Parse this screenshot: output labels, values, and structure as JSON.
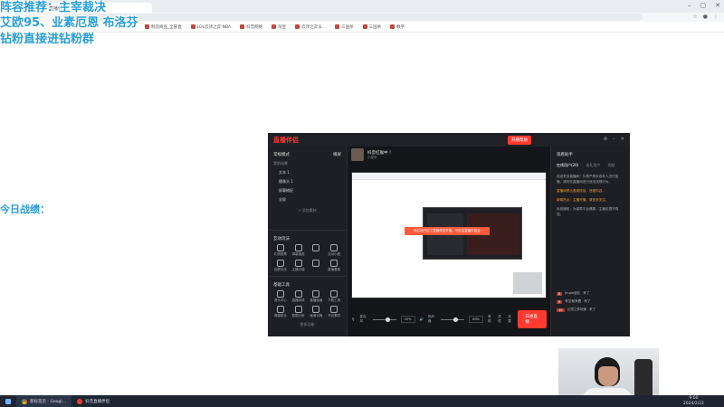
{
  "overlay": {
    "line1": "阵容推荐：主宰裁决",
    "line2": "艾欧95、业素厄恩  布洛芬",
    "line3": "钻粉直接进钻粉群",
    "line4": "今日战绩："
  },
  "browser": {
    "active_tab": "直播伴侣",
    "bookmarks": [
      "制造商品_全部直",
      "LOL云顶之弈·NBA",
      "抖音网络",
      "淘宝",
      "云顶之弈法…",
      "三国杀",
      "三国杀",
      "数字"
    ]
  },
  "app": {
    "logo": "直播伴侣",
    "start_live_top": "开播帮助",
    "left": {
      "mode": "常规模式",
      "right_link": "横屏",
      "scenes_label": "我的场景",
      "scene_items": [
        "文本 1",
        "摄像头 1",
        "屏幕捕捉",
        "全屏"
      ],
      "add_source": "+ 添加素材",
      "interactive_title": "互动玩法",
      "interactive_tools": [
        "礼物投票",
        "弹幕抽奖",
        "",
        "互动小程",
        "抽奖玩法",
        "主播口袋",
        "",
        "直播看板"
      ],
      "basic_title": "基础工具",
      "basic_tools": [
        "音乐中心",
        "直播特效",
        "直播画面",
        "下载工具",
        "弹幕助手",
        "数据分析",
        "画面切换",
        "节目素材"
      ],
      "more": "更多功能"
    },
    "center": {
      "streamer_name": "抖音红猴中 ！",
      "streamer_sub": "小皇帝",
      "toast": "你已经开启了直播伴侣开播，可前往直播中控台",
      "cam_label": "麦克风",
      "cam_pct": "10%",
      "mic_label": "扬声器",
      "mic_pct": "60%",
      "btn_effect": "美颜",
      "btn_sticker": "滤镜",
      "btn_setting": "设置",
      "start_live": "开始直播"
    },
    "right": {
      "title": "观看助手",
      "tabs": [
        "在线用户(20)",
        "送礼用户",
        "贡献"
      ],
      "msg1": "欢迎来到直播间！抖音严禁未成年人进行直播，请勿在直播间进行违法违规行为。",
      "msg2": "直播间禁止各类低俗、违规内容。",
      "msg3": "新闻热点：主播开播，请多多关注。",
      "msg4": "系统通知：为保障平台健康，主播应遵守规范。",
      "users": [
        {
          "lv": "8",
          "name": "jingle朋友",
          "act": "来了"
        },
        {
          "lv": "9",
          "name": "有空就来看",
          "act": "来了"
        },
        {
          "lv": "10",
          "name": "云顶之弈玩家",
          "act": "来了"
        }
      ]
    }
  },
  "taskbar": {
    "item1": "新标签页 - Googl…",
    "item2": "抖音直播伴侣",
    "time": "9:00",
    "date": "2024/2/22"
  }
}
